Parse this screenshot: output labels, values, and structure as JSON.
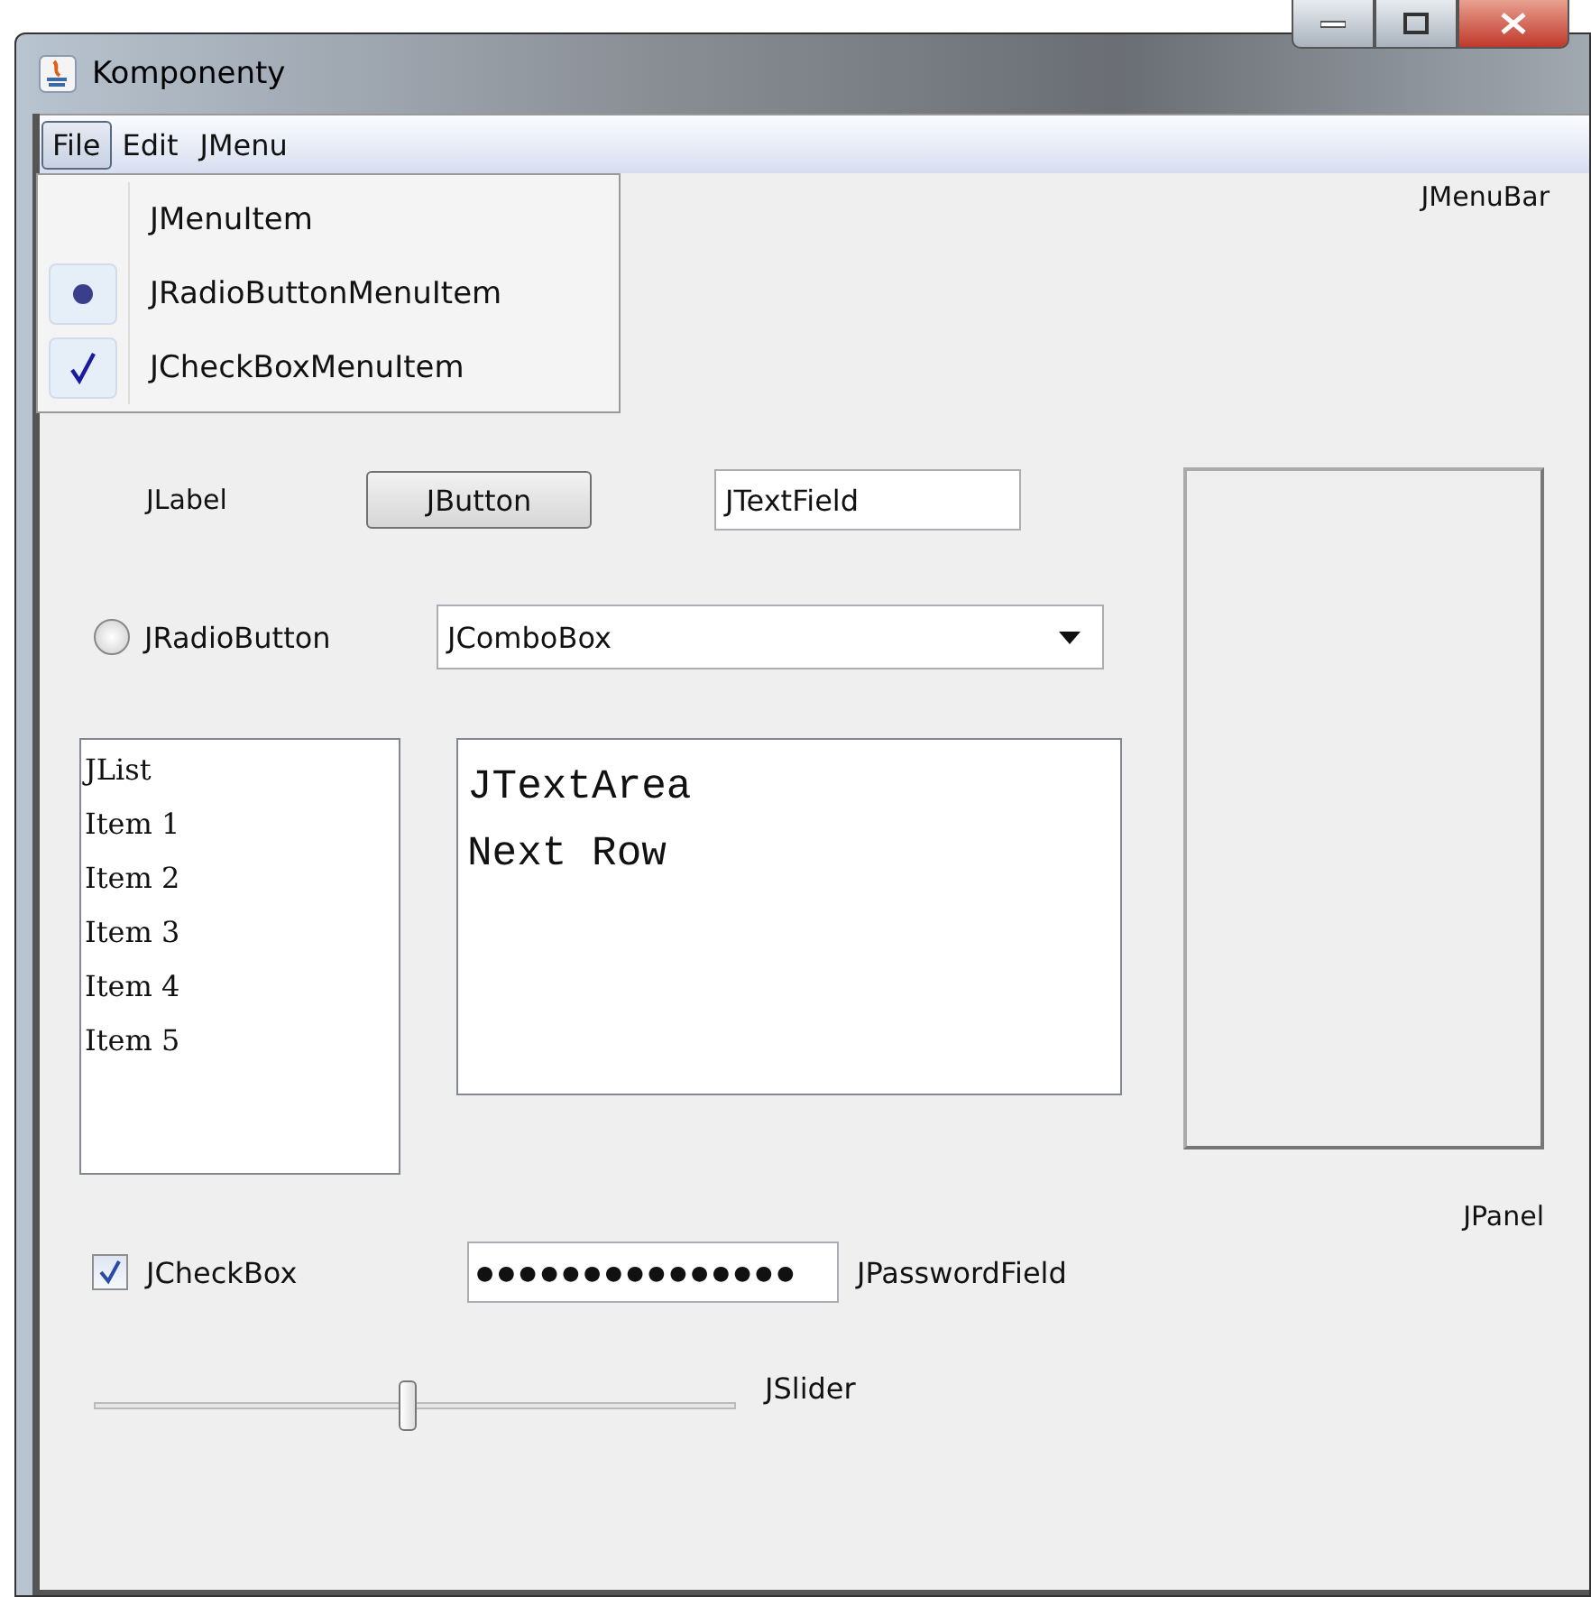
{
  "window": {
    "title": "Komponenty"
  },
  "menu_bar": {
    "menus": [
      {
        "label": "File",
        "selected": true
      },
      {
        "label": "Edit",
        "selected": false
      },
      {
        "label": "JMenu",
        "selected": false
      }
    ]
  },
  "open_menu": {
    "items": [
      {
        "kind": "plain",
        "label": "JMenuItem"
      },
      {
        "kind": "radio",
        "label": "JRadioButtonMenuItem",
        "checked": true
      },
      {
        "kind": "check",
        "label": "JCheckBoxMenuItem",
        "checked": true
      }
    ]
  },
  "menu_bar_caption": "JMenuBar",
  "label": "JLabel",
  "button": {
    "label": "JButton"
  },
  "text_field": {
    "value": "JTextField"
  },
  "radio_button": {
    "label": "JRadioButton",
    "selected": false
  },
  "combo_box": {
    "value": "JComboBox"
  },
  "list": {
    "items": [
      "JList",
      "Item 1",
      "Item 2",
      "Item 3",
      "Item 4",
      "Item 5"
    ]
  },
  "text_area": {
    "lines": [
      "JTextArea",
      "Next Row"
    ]
  },
  "panel_caption": "JPanel",
  "check_box": {
    "label": "JCheckBox",
    "checked": true
  },
  "password_field": {
    "value": "●●●●●●●●●●●●●●●"
  },
  "password_caption": "JPasswordField",
  "slider": {
    "level": 0.49
  },
  "slider_caption": "JSlider"
}
